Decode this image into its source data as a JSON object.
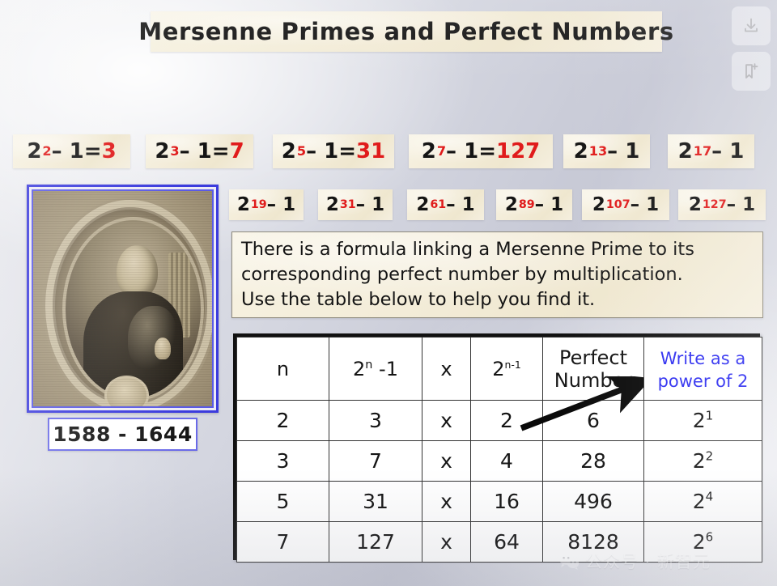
{
  "slide": {
    "title": "Mersenne Primes and Perfect Numbers",
    "background_color": "#d3d5de",
    "parchment_color": "#f3ecd8",
    "accent_red": "#e01b1b",
    "accent_blue": "#2b2bf0"
  },
  "formulas": {
    "row1": [
      {
        "base": "2",
        "exponent": "2",
        "minus": " – 1",
        "equals": " = ",
        "result": "3"
      },
      {
        "base": "2",
        "exponent": "3",
        "minus": " – 1",
        "equals": " = ",
        "result": "7"
      },
      {
        "base": "2",
        "exponent": "5",
        "minus": " – 1",
        "equals": " = ",
        "result": "31"
      },
      {
        "base": "2",
        "exponent": "7",
        "minus": " – 1",
        "equals": " = ",
        "result": "127"
      },
      {
        "base": "2",
        "exponent": "13",
        "minus": " – 1",
        "equals": "",
        "result": ""
      },
      {
        "base": "2",
        "exponent": "17",
        "minus": " – 1",
        "equals": "",
        "result": ""
      }
    ],
    "row2": [
      {
        "base": "2",
        "exponent": "19",
        "minus": " – 1",
        "equals": "",
        "result": ""
      },
      {
        "base": "2",
        "exponent": "31",
        "minus": " – 1",
        "equals": "",
        "result": ""
      },
      {
        "base": "2",
        "exponent": "61",
        "minus": " – 1",
        "equals": "",
        "result": ""
      },
      {
        "base": "2",
        "exponent": "89",
        "minus": " – 1",
        "equals": "",
        "result": ""
      },
      {
        "base": "2",
        "exponent": "107",
        "minus": " – 1",
        "equals": "",
        "result": ""
      },
      {
        "base": "2",
        "exponent": "127",
        "minus": " – 1",
        "equals": "",
        "result": ""
      }
    ]
  },
  "explanation": {
    "line1": "There is a formula linking a Mersenne Prime to its",
    "line2": "corresponding perfect number by multiplication.",
    "line3": "Use the table below to help you find it."
  },
  "portrait": {
    "caption": "1588 - 1644",
    "description": "engraved oval portrait of Marin Mersenne"
  },
  "table": {
    "headers": {
      "n": "n",
      "mersenne_base": "2",
      "mersenne_exp": "n",
      "mersenne_tail": " -1",
      "times": "x",
      "power_base": "2",
      "power_exp": "n-1",
      "perfect_line1": "Perfect",
      "perfect_line2": "Number",
      "write_line1": "Write as a",
      "write_line2": "power of 2"
    },
    "rows": [
      {
        "n": "2",
        "mersenne": "3",
        "times": "x",
        "power": "2",
        "perfect": "6",
        "as_power_base": "2",
        "as_power_exp": "1"
      },
      {
        "n": "3",
        "mersenne": "7",
        "times": "x",
        "power": "4",
        "perfect": "28",
        "as_power_base": "2",
        "as_power_exp": "2"
      },
      {
        "n": "5",
        "mersenne": "31",
        "times": "x",
        "power": "16",
        "perfect": "496",
        "as_power_base": "2",
        "as_power_exp": "4"
      },
      {
        "n": "7",
        "mersenne": "127",
        "times": "x",
        "power": "64",
        "perfect": "8128",
        "as_power_base": "2",
        "as_power_exp": "6"
      }
    ]
  },
  "overlay_buttons": {
    "download_label": "download-icon",
    "bookmark_label": "bookmark-add-icon"
  },
  "watermark": {
    "text": "公众号 · 新智元"
  }
}
